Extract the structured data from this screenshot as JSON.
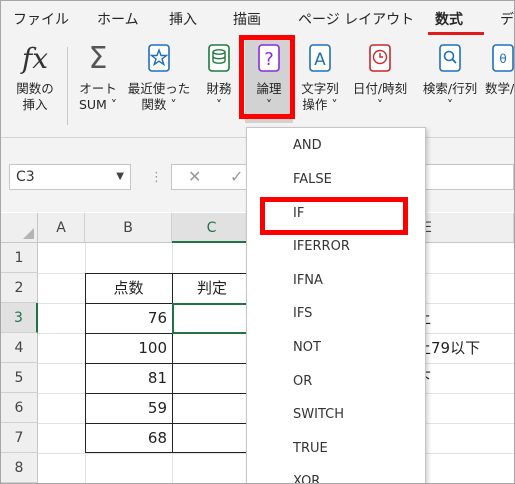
{
  "ribbon_tabs": [
    {
      "label": "ファイル",
      "active": false
    },
    {
      "label": "ホーム",
      "active": false
    },
    {
      "label": "挿入",
      "active": false
    },
    {
      "label": "描画",
      "active": false
    },
    {
      "label": "ページ レイアウト",
      "active": false
    },
    {
      "label": "数式",
      "active": true
    },
    {
      "label": "デ",
      "active": false
    }
  ],
  "ribbon_buttons": {
    "insert_function": {
      "icon": "fx-icon",
      "line1": "関数の",
      "line2": "挿入"
    },
    "autosum": {
      "icon": "sigma-icon",
      "line1": "オート",
      "line2": "SUM ˅"
    },
    "recent": {
      "icon": "star-book-icon",
      "line1": "最近使った",
      "line2": "関数 ˅"
    },
    "financial": {
      "icon": "coins-book-icon",
      "line1": "財務",
      "line2": "˅"
    },
    "logical": {
      "icon": "question-book-icon",
      "line1": "論理",
      "line2": "˅"
    },
    "text": {
      "icon": "letter-a-book-icon",
      "line1": "文字列",
      "line2": "操作 ˅"
    },
    "datetime": {
      "icon": "clock-book-icon",
      "line1": "日付/時刻",
      "line2": "˅"
    },
    "lookup": {
      "icon": "magnifier-book-icon",
      "line1": "検索/行列",
      "line2": "˅"
    },
    "math": {
      "icon": "math-book-icon",
      "line1": "数学/",
      "line2": ""
    }
  },
  "colors": {
    "highlight": "#ff0000",
    "selection": "#217346",
    "tab_underline": "#e31b1b"
  },
  "formula_bar": {
    "name_box": "C3",
    "dots": "⋮",
    "cancel": "✕",
    "enter": "✓"
  },
  "columns": [
    "A",
    "B",
    "C",
    "D",
    "E"
  ],
  "rows": [
    "1",
    "2",
    "3",
    "4",
    "5",
    "6",
    "7",
    "8"
  ],
  "selected_cell": {
    "column": "C",
    "row": "3"
  },
  "table": {
    "header_score": "点数",
    "header_judge": "判定",
    "scores": [
      "76",
      "100",
      "81",
      "59",
      "68"
    ]
  },
  "side_fragments": [
    "上",
    "上79以下",
    "下"
  ],
  "logical_menu": {
    "items": [
      "AND",
      "FALSE",
      "IF",
      "IFERROR",
      "IFNA",
      "IFS",
      "NOT",
      "OR",
      "SWITCH",
      "TRUE",
      "XOR"
    ],
    "highlighted": "IF"
  }
}
